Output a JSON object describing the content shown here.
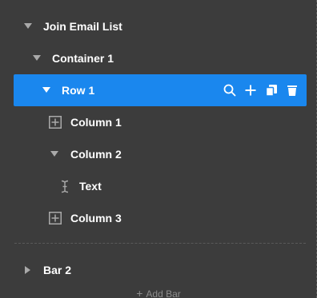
{
  "tree": {
    "items": [
      {
        "label": "Join Email List",
        "icon": "caret-down-icon"
      },
      {
        "label": "Container 1",
        "icon": "caret-down-icon"
      },
      {
        "label": "Row 1",
        "icon": "caret-down-icon",
        "selected": true
      },
      {
        "label": "Column 1",
        "icon": "expand-box-icon"
      },
      {
        "label": "Column 2",
        "icon": "caret-down-icon"
      },
      {
        "label": "Text",
        "icon": "text-cursor-icon"
      },
      {
        "label": "Column 3",
        "icon": "expand-box-icon"
      },
      {
        "label": "Bar 2",
        "icon": "caret-right-icon"
      }
    ],
    "selected_actions": [
      "search-icon",
      "plus-icon",
      "duplicate-icon",
      "delete-icon"
    ]
  },
  "footer": {
    "add_bar_label": "Add Bar"
  },
  "colors": {
    "background": "#3c3c3c",
    "selected": "#1a87ee",
    "text": "#ffffff",
    "muted": "#a9a9a9"
  }
}
